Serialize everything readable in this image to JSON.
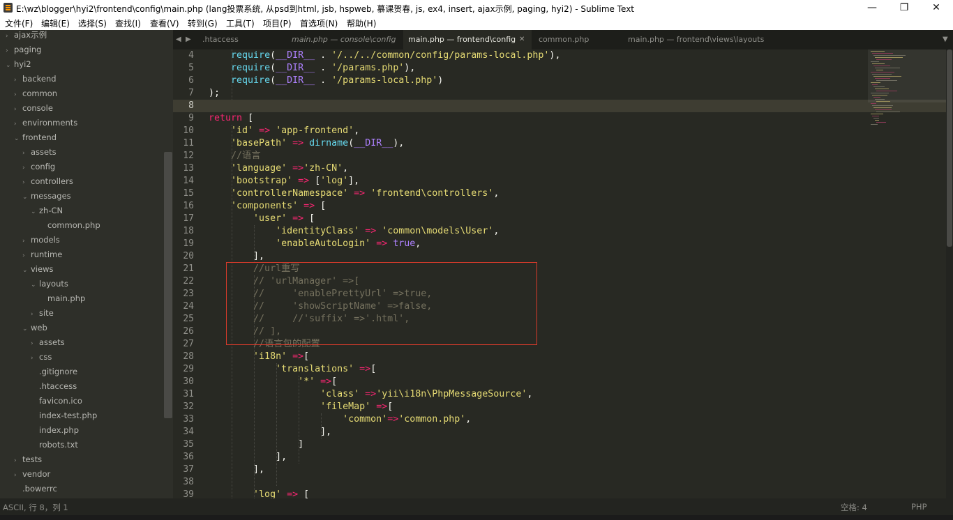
{
  "window": {
    "title": "E:\\wz\\blogger\\hyi2\\frontend\\config\\main.php (lang投票系统, 从psd到html, jsb, hspweb, 慕课贺春, js, ex4, insert, ajax示例, paging, hyi2) - Sublime Text",
    "minimize": "—",
    "maximize": "❐",
    "close": "✕"
  },
  "menu": [
    "文件(F)",
    "编辑(E)",
    "选择(S)",
    "查找(I)",
    "查看(V)",
    "转到(G)",
    "工具(T)",
    "项目(P)",
    "首选项(N)",
    "帮助(H)"
  ],
  "sidebar": {
    "items": [
      {
        "label": "ajax示例",
        "arrow": "›"
      },
      {
        "label": "paging",
        "arrow": "›"
      },
      {
        "label": "hyi2",
        "arrow": "⌄"
      },
      {
        "label": "backend",
        "arrow": "›"
      },
      {
        "label": "common",
        "arrow": "›"
      },
      {
        "label": "console",
        "arrow": "›"
      },
      {
        "label": "environments",
        "arrow": "›"
      },
      {
        "label": "frontend",
        "arrow": "⌄"
      },
      {
        "label": "assets",
        "arrow": "›"
      },
      {
        "label": "config",
        "arrow": "›"
      },
      {
        "label": "controllers",
        "arrow": "›"
      },
      {
        "label": "messages",
        "arrow": "⌄"
      },
      {
        "label": "zh-CN",
        "arrow": "⌄"
      },
      {
        "label": "common.php",
        "arrow": ""
      },
      {
        "label": "models",
        "arrow": "›"
      },
      {
        "label": "runtime",
        "arrow": "›"
      },
      {
        "label": "views",
        "arrow": "⌄"
      },
      {
        "label": "layouts",
        "arrow": "⌄"
      },
      {
        "label": "main.php",
        "arrow": ""
      },
      {
        "label": "site",
        "arrow": "›"
      },
      {
        "label": "web",
        "arrow": "⌄"
      },
      {
        "label": "assets",
        "arrow": "›"
      },
      {
        "label": "css",
        "arrow": "›"
      },
      {
        "label": ".gitignore",
        "arrow": ""
      },
      {
        "label": ".htaccess",
        "arrow": ""
      },
      {
        "label": "favicon.ico",
        "arrow": ""
      },
      {
        "label": "index-test.php",
        "arrow": ""
      },
      {
        "label": "index.php",
        "arrow": ""
      },
      {
        "label": "robots.txt",
        "arrow": ""
      },
      {
        "label": "tests",
        "arrow": "›"
      },
      {
        "label": "vendor",
        "arrow": "›"
      },
      {
        "label": ".bowerrc",
        "arrow": ""
      }
    ]
  },
  "tabs": {
    "nav_left": "◀",
    "nav_right": "▶",
    "items": [
      {
        "label": ".htaccess"
      },
      {
        "label": "main.php — console\\config"
      },
      {
        "label": "main.php — frontend\\config",
        "close": "✕"
      },
      {
        "label": "common.php"
      },
      {
        "label": "main.php — frontend\\views\\layouts"
      }
    ],
    "overflow": "▼"
  },
  "editor": {
    "current_line": 8,
    "lines": [
      {
        "n": 4,
        "html": "    <span class=\"fn\">require</span>(<span class=\"cst\">__DIR__</span> . <span class=\"str\">'/../../common/config/params-local.php'</span>),"
      },
      {
        "n": 5,
        "html": "    <span class=\"fn\">require</span>(<span class=\"cst\">__DIR__</span> . <span class=\"str\">'/params.php'</span>),"
      },
      {
        "n": 6,
        "html": "    <span class=\"fn\">require</span>(<span class=\"cst\">__DIR__</span> . <span class=\"str\">'/params-local.php'</span>)"
      },
      {
        "n": 7,
        "html": ");"
      },
      {
        "n": 8,
        "html": ""
      },
      {
        "n": 9,
        "html": "<span class=\"kw\">return</span> ["
      },
      {
        "n": 10,
        "html": "    <span class=\"str\">'id'</span> <span class=\"kw\">=></span> <span class=\"str\">'app-frontend'</span>,"
      },
      {
        "n": 11,
        "html": "    <span class=\"str\">'basePath'</span> <span class=\"kw\">=></span> <span class=\"fn\">dirname</span>(<span class=\"cst\">__DIR__</span>),"
      },
      {
        "n": 12,
        "html": "    <span class=\"cm\">//语言</span>"
      },
      {
        "n": 13,
        "html": "    <span class=\"str\">'language'</span> <span class=\"kw\">=></span><span class=\"str\">'zh-CN'</span>,"
      },
      {
        "n": 14,
        "html": "    <span class=\"str\">'bootstrap'</span> <span class=\"kw\">=></span> [<span class=\"str\">'log'</span>],"
      },
      {
        "n": 15,
        "html": "    <span class=\"str\">'controllerNamespace'</span> <span class=\"kw\">=></span> <span class=\"str\">'frontend\\controllers'</span>,"
      },
      {
        "n": 16,
        "html": "    <span class=\"str\">'components'</span> <span class=\"kw\">=></span> ["
      },
      {
        "n": 17,
        "html": "        <span class=\"str\">'user'</span> <span class=\"kw\">=></span> ["
      },
      {
        "n": 18,
        "html": "            <span class=\"str\">'identityClass'</span> <span class=\"kw\">=></span> <span class=\"str\">'common\\models\\User'</span>,"
      },
      {
        "n": 19,
        "html": "            <span class=\"str\">'enableAutoLogin'</span> <span class=\"kw\">=></span> <span class=\"cst\">true</span>,"
      },
      {
        "n": 20,
        "html": "        ],"
      },
      {
        "n": 21,
        "html": "        <span class=\"cm\">//url重写</span>"
      },
      {
        "n": 22,
        "html": "        <span class=\"cm\">// 'urlManager' =>[</span>"
      },
      {
        "n": 23,
        "html": "        <span class=\"cm\">//     'enablePrettyUrl' =>true,</span>"
      },
      {
        "n": 24,
        "html": "        <span class=\"cm\">//     'showScriptName' =>false,</span>"
      },
      {
        "n": 25,
        "html": "        <span class=\"cm\">//     //'suffix' =>'.html',</span>"
      },
      {
        "n": 26,
        "html": "        <span class=\"cm\">// ],</span>"
      },
      {
        "n": 27,
        "html": "        <span class=\"cm\">//语言包的配置</span>"
      },
      {
        "n": 28,
        "html": "        <span class=\"str\">'i18n'</span> <span class=\"kw\">=></span>["
      },
      {
        "n": 29,
        "html": "            <span class=\"str\">'translations'</span> <span class=\"kw\">=></span>["
      },
      {
        "n": 30,
        "html": "                <span class=\"str\">'*'</span> <span class=\"kw\">=></span>["
      },
      {
        "n": 31,
        "html": "                    <span class=\"str\">'class'</span> <span class=\"kw\">=></span><span class=\"str\">'yii\\i18n\\PhpMessageSource'</span>,"
      },
      {
        "n": 32,
        "html": "                    <span class=\"str\">'fileMap'</span> <span class=\"kw\">=></span>["
      },
      {
        "n": 33,
        "html": "                        <span class=\"str\">'common'</span><span class=\"kw\">=></span><span class=\"str\">'common.php'</span>,"
      },
      {
        "n": 34,
        "html": "                    ],"
      },
      {
        "n": 35,
        "html": "                ]"
      },
      {
        "n": 36,
        "html": "            ],"
      },
      {
        "n": 37,
        "html": "        ],"
      },
      {
        "n": 38,
        "html": ""
      },
      {
        "n": 39,
        "html": "        <span class=\"str\">'log'</span> <span class=\"kw\">=></span> ["
      }
    ]
  },
  "status": {
    "left": "ASCII, 行 8，列 1",
    "indent": "空格: 4",
    "syntax": "PHP"
  },
  "colors": {
    "background": "#282923",
    "keyword": "#f92672",
    "string": "#e6db74",
    "constant": "#ae81ff",
    "function": "#66d9ef",
    "comment": "#75715e",
    "highlight_box": "#d93b2b"
  }
}
